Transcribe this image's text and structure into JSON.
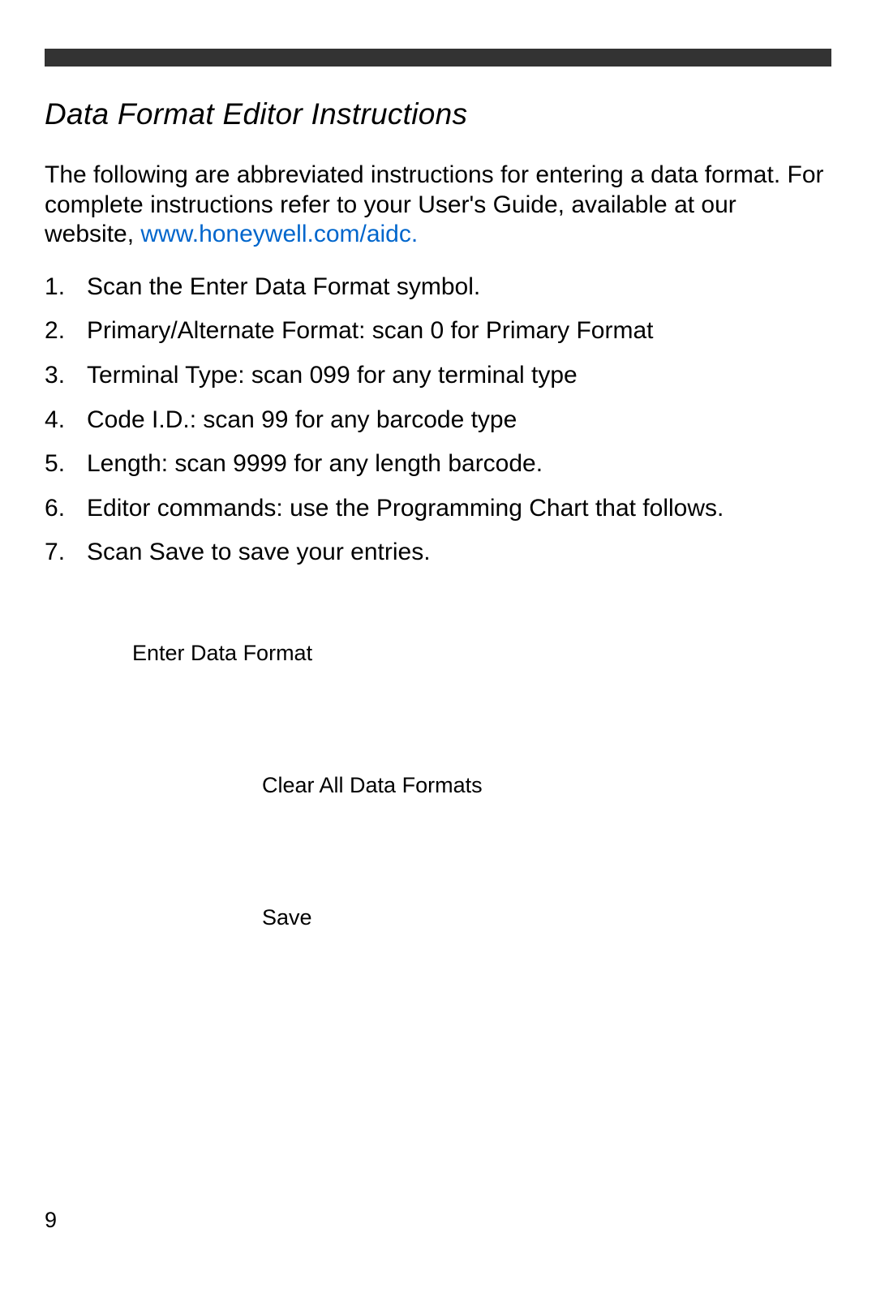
{
  "section_title": "Data Format Editor Instructions",
  "intro_text_part1": "The following are abbreviated instructions for entering a data format.  For complete instructions refer to your User's Guide, available at our website, ",
  "website_link": "www.honeywell.com/aidc.",
  "instructions": [
    "Scan the Enter Data Format symbol.",
    "Primary/Alternate Format: scan 0 for Primary Format",
    "Terminal Type: scan 099 for any terminal type",
    "Code I.D.: scan 99 for any barcode type",
    "Length: scan 9999 for any length barcode.",
    "Editor commands: use the Programming Chart that follows.",
    "Scan Save to save your entries."
  ],
  "barcode_labels": {
    "enter_data_format": "Enter Data Format",
    "clear_all": "Clear All Data Formats",
    "save": "Save"
  },
  "page_number": "9"
}
